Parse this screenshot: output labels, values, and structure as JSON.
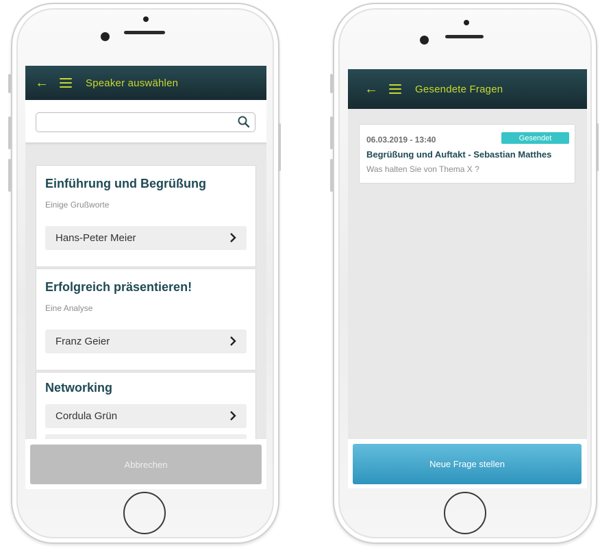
{
  "left_screen": {
    "header": {
      "back_icon": "arrow-left-icon",
      "menu_icon": "hamburger-menu-icon",
      "title": "Speaker auswählen"
    },
    "search": {
      "value": "",
      "placeholder": "",
      "icon": "search-icon"
    },
    "sessions": [
      {
        "title": "Einführung und Begrüßung",
        "subtitle": "Einige Grußworte",
        "speakers": [
          "Hans-Peter Meier"
        ]
      },
      {
        "title": "Erfolgreich präsentieren!",
        "subtitle": "Eine Analyse",
        "speakers": [
          "Franz Geier"
        ]
      },
      {
        "title": "Networking",
        "subtitle": "",
        "speakers": [
          "Cordula Grün"
        ]
      }
    ],
    "footer": {
      "cancel_label": "Abbrechen"
    }
  },
  "right_screen": {
    "header": {
      "back_icon": "arrow-left-icon",
      "menu_icon": "hamburger-menu-icon",
      "title": "Gesendete Fragen"
    },
    "questions": [
      {
        "datetime": "06.03.2019 - 13:40",
        "status": "Gesendet",
        "session": "Begrüßung und Auftakt - Sebastian Matthes",
        "text": "Was halten Sie von Thema X ?"
      }
    ],
    "footer": {
      "new_question_label": "Neue Frage stellen"
    }
  },
  "colors": {
    "header_bg": "#1f3a41",
    "header_accent": "#c6d92f",
    "title_text": "#1f4a55",
    "badge": "#38c4c7",
    "primary_button": "#3fa3c8",
    "cancel_button": "#bdbdbd"
  }
}
